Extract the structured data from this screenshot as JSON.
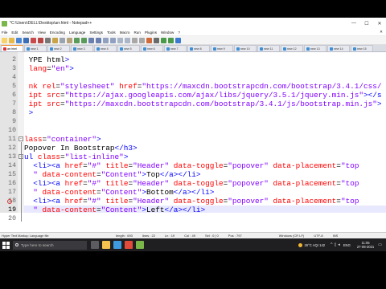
{
  "window": {
    "title": "*C:\\Users\\DELL\\Desktop\\arr.html - Notepad++",
    "controls": [
      "—",
      "☐",
      "✕"
    ]
  },
  "menu": {
    "items": [
      "File",
      "Edit",
      "Search",
      "View",
      "Encoding",
      "Language",
      "Settings",
      "Tools",
      "Macro",
      "Run",
      "Plugins",
      "Window",
      "?"
    ],
    "close": "✕"
  },
  "tabs": [
    "arr.html",
    "new 1",
    "new 2",
    "new 3",
    "new 4",
    "new 5",
    "new 6",
    "new 7",
    "new 8",
    "new 9",
    "new 10",
    "new 11",
    "new 12",
    "new 13",
    "new 14",
    "new 15"
  ],
  "editor": {
    "current_line": 19,
    "lines": [
      {
        "n": "2",
        "fold": "",
        "segs": [
          {
            "c": "k",
            "t": " YPE html"
          },
          {
            "c": "t",
            "t": ">"
          }
        ]
      },
      {
        "n": "3",
        "fold": "",
        "segs": [
          {
            "c": "a",
            "t": " lang"
          },
          {
            "c": "p",
            "t": "="
          },
          {
            "c": "v",
            "t": "\"en\""
          },
          {
            "c": "t",
            "t": ">"
          }
        ]
      },
      {
        "n": "4",
        "fold": "",
        "segs": []
      },
      {
        "n": "5",
        "fold": "",
        "segs": [
          {
            "c": "a",
            "t": " nk rel"
          },
          {
            "c": "p",
            "t": "="
          },
          {
            "c": "v",
            "t": "\"stylesheet\""
          },
          {
            "c": "a",
            "t": " href"
          },
          {
            "c": "p",
            "t": "="
          },
          {
            "c": "v",
            "t": "\"https://maxcdn.bootstrapcdn.com/bootstrap/3.4.1/css/"
          }
        ]
      },
      {
        "n": "6",
        "fold": "",
        "segs": [
          {
            "c": "a",
            "t": " ipt src"
          },
          {
            "c": "p",
            "t": "="
          },
          {
            "c": "v",
            "t": "\"https://ajax.googleapis.com/ajax/libs/jquery/3.5.1/jquery.min.js\""
          },
          {
            "c": "t",
            "t": "></s"
          }
        ]
      },
      {
        "n": "7",
        "fold": "",
        "segs": [
          {
            "c": "a",
            "t": " ipt src"
          },
          {
            "c": "p",
            "t": "="
          },
          {
            "c": "v",
            "t": "\"https://maxcdn.bootstrapcdn.com/bootstrap/3.4.1/js/bootstrap.min.js\""
          },
          {
            "c": "t",
            "t": ">"
          }
        ]
      },
      {
        "n": "8",
        "fold": "",
        "segs": [
          {
            "c": "t",
            "t": " >"
          }
        ]
      },
      {
        "n": "9",
        "fold": "",
        "segs": []
      },
      {
        "n": "10",
        "fold": "",
        "segs": []
      },
      {
        "n": "11",
        "fold": "box",
        "segs": [
          {
            "c": "a",
            "t": "lass"
          },
          {
            "c": "p",
            "t": "="
          },
          {
            "c": "v",
            "t": "\"container\""
          },
          {
            "c": "t",
            "t": ">"
          }
        ]
      },
      {
        "n": "12",
        "fold": "",
        "segs": [
          {
            "c": "k",
            "t": "Popover In Bootstrap"
          },
          {
            "c": "t",
            "t": "</h3>"
          }
        ]
      },
      {
        "n": "13",
        "fold": "box",
        "segs": [
          {
            "c": "t",
            "t": "ul"
          },
          {
            "c": "a",
            "t": " class"
          },
          {
            "c": "p",
            "t": "="
          },
          {
            "c": "v",
            "t": "\"list-inline\""
          },
          {
            "c": "t",
            "t": ">"
          }
        ]
      },
      {
        "n": "14",
        "fold": "",
        "segs": [
          {
            "c": "t",
            "t": "  <li><a"
          },
          {
            "c": "a",
            "t": " href"
          },
          {
            "c": "p",
            "t": "="
          },
          {
            "c": "v",
            "t": "\"#\""
          },
          {
            "c": "a",
            "t": " title"
          },
          {
            "c": "p",
            "t": "="
          },
          {
            "c": "v",
            "t": "\"Header\""
          },
          {
            "c": "a",
            "t": " data-toggle"
          },
          {
            "c": "p",
            "t": "="
          },
          {
            "c": "v",
            "t": "\"popover\""
          },
          {
            "c": "a",
            "t": " data-placement"
          },
          {
            "c": "p",
            "t": "="
          },
          {
            "c": "v",
            "t": "\"top"
          }
        ]
      },
      {
        "n": "15",
        "fold": "",
        "segs": [
          {
            "c": "v",
            "t": "  \""
          },
          {
            "c": "a",
            "t": " data-content"
          },
          {
            "c": "p",
            "t": "="
          },
          {
            "c": "v",
            "t": "\"Content\""
          },
          {
            "c": "t",
            "t": ">"
          },
          {
            "c": "k",
            "t": "Top"
          },
          {
            "c": "t",
            "t": "</a></li>"
          }
        ]
      },
      {
        "n": "16",
        "fold": "",
        "segs": [
          {
            "c": "t",
            "t": "  <li><a"
          },
          {
            "c": "a",
            "t": " href"
          },
          {
            "c": "p",
            "t": "="
          },
          {
            "c": "v",
            "t": "\"#\""
          },
          {
            "c": "a",
            "t": " title"
          },
          {
            "c": "p",
            "t": "="
          },
          {
            "c": "v",
            "t": "\"Header\""
          },
          {
            "c": "a",
            "t": " data-toggle"
          },
          {
            "c": "p",
            "t": "="
          },
          {
            "c": "v",
            "t": "\"popover\""
          },
          {
            "c": "a",
            "t": " data-placement"
          },
          {
            "c": "p",
            "t": "="
          },
          {
            "c": "v",
            "t": "\"top"
          }
        ]
      },
      {
        "n": "17",
        "fold": "",
        "segs": [
          {
            "c": "v",
            "t": "  \""
          },
          {
            "c": "a",
            "t": " data-content"
          },
          {
            "c": "p",
            "t": "="
          },
          {
            "c": "v",
            "t": "\"Content\""
          },
          {
            "c": "t",
            "t": ">"
          },
          {
            "c": "k",
            "t": "Bottom"
          },
          {
            "c": "t",
            "t": "</a></li>"
          }
        ]
      },
      {
        "n": "18",
        "fold": "",
        "segs": [
          {
            "c": "t",
            "t": "  <li><a"
          },
          {
            "c": "a",
            "t": " href"
          },
          {
            "c": "p",
            "t": "="
          },
          {
            "c": "v",
            "t": "\"#\""
          },
          {
            "c": "a",
            "t": " title"
          },
          {
            "c": "p",
            "t": "="
          },
          {
            "c": "v",
            "t": "\"Header\""
          },
          {
            "c": "a",
            "t": " data-toggle"
          },
          {
            "c": "p",
            "t": "="
          },
          {
            "c": "v",
            "t": "\"popover\""
          },
          {
            "c": "a",
            "t": " data-placement"
          },
          {
            "c": "p",
            "t": "="
          },
          {
            "c": "v",
            "t": "\"top"
          }
        ]
      },
      {
        "n": "19",
        "fold": "",
        "segs": [
          {
            "c": "v",
            "t": "  \""
          },
          {
            "c": "a",
            "t": " data-content"
          },
          {
            "c": "p",
            "t": "="
          },
          {
            "c": "v",
            "t": "\"Content\""
          },
          {
            "c": "t",
            "t": ">"
          },
          {
            "c": "k",
            "t": "Left"
          },
          {
            "c": "t",
            "t": "</a></li>"
          }
        ]
      },
      {
        "n": "20",
        "fold": "",
        "segs": [
          {
            "c": "t",
            "t": "/ul>"
          }
        ]
      }
    ]
  },
  "status": {
    "file_type": "Hyper Text Markup Language file",
    "length": "length : 693",
    "lines": "lines : 22",
    "ln": "Ln : 19",
    "col": "Col : 49",
    "sel": "Sel : 0 | 0",
    "pos": "Pos : 797",
    "eol": "Windows (CR LF)",
    "encoding": "UTF-8",
    "mode": "INS"
  },
  "taskbar": {
    "search_placeholder": "Type here to search",
    "weather": "26°C  AQI 142",
    "lang": "ENG",
    "time": "11:05",
    "date": "27-08-2021"
  },
  "colors": {
    "tag": "#0000ff",
    "attribute": "#ff0000",
    "value": "#8000ff",
    "current_line_bg": "#e8e8ff",
    "active_tab_accent": "#f08a24"
  }
}
